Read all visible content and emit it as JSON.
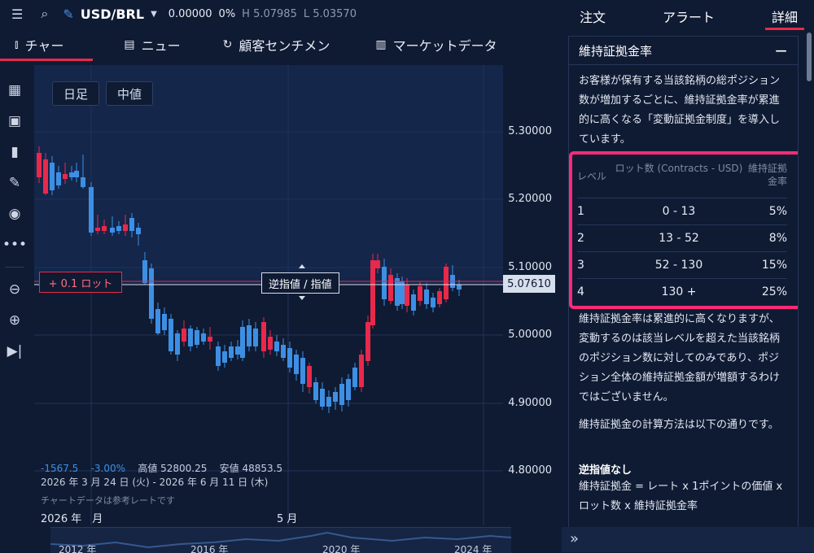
{
  "topbar": {
    "menu_icon": "hamburger-icon",
    "search_icon": "search-icon",
    "edit_icon": "pencil-icon",
    "symbol": "USD/BRL",
    "price": "0.00000",
    "change": "0%",
    "high": "H 5.07985",
    "low": "L 5.03570"
  },
  "tabs": [
    {
      "label": "チャー",
      "icon": "candlestick-icon"
    },
    {
      "label": "ニュー",
      "icon": "newspaper-icon"
    },
    {
      "label": "顧客センチメン",
      "icon": "refresh-icon"
    },
    {
      "label": "マーケットデータ",
      "icon": "clipboard-icon"
    }
  ],
  "chart": {
    "timeframe": "日足",
    "price_type": "中値",
    "lot_button": "+ 0.1 ロット",
    "order_label": "逆指値 / 指値",
    "current_price": "5.07610",
    "price_ticks": [
      "5.30000",
      "5.20000",
      "5.10000",
      "5.00000",
      "4.90000",
      "4.80000"
    ],
    "stats": {
      "change": "-1567.5",
      "percent": "-3.00%",
      "high": "高値 52800.25",
      "low": "安値 48853.5"
    },
    "date_range": "2026 年 3 月 24 日 (火) - 2026 年 6 月 11 日 (木)",
    "note": "チャートデータは参考レートです",
    "x_labels": [
      "2026 年　月",
      "5 月"
    ],
    "navigator_years": [
      "2012 年",
      "2016 年",
      "2020 年",
      "2024 年"
    ]
  },
  "panel": {
    "tabs": [
      "注文",
      "アラート",
      "詳細"
    ],
    "title": "維持証拠金率",
    "collapse": "−",
    "intro": "お客様が保有する当該銘柄の総ポジション数が増加するごとに、維持証拠金率が累進的に高くなる「変動証拠金制度」を導入しています。",
    "table_header": {
      "level": "レベル",
      "lots": "ロット数 (Contracts - USD)",
      "rate": "維持証拠金率"
    },
    "rows": [
      {
        "level": "1",
        "lots": "0 - 13",
        "rate": "5%"
      },
      {
        "level": "2",
        "lots": "13 - 52",
        "rate": "8%"
      },
      {
        "level": "3",
        "lots": "52 - 130",
        "rate": "15%"
      },
      {
        "level": "4",
        "lots": "130 +",
        "rate": "25%"
      }
    ],
    "para2": "維持証拠金率は累進的に高くなりますが、変動するのは該当レベルを超えた当該銘柄のポジション数に対してのみであり、ポジション全体の維持証拠金額が増額するわけではございません。",
    "para3": "維持証拠金の計算方法は以下の通りです。",
    "subtitle": "逆指値なし",
    "formula": "維持証拠金 = レート x 1ポイントの価値 x ロット数 x 維持証拠金率"
  },
  "colors": {
    "up": "#e8294b",
    "down": "#3d8fe4",
    "bg": "#0f1b33",
    "accent": "#ff2a77"
  }
}
